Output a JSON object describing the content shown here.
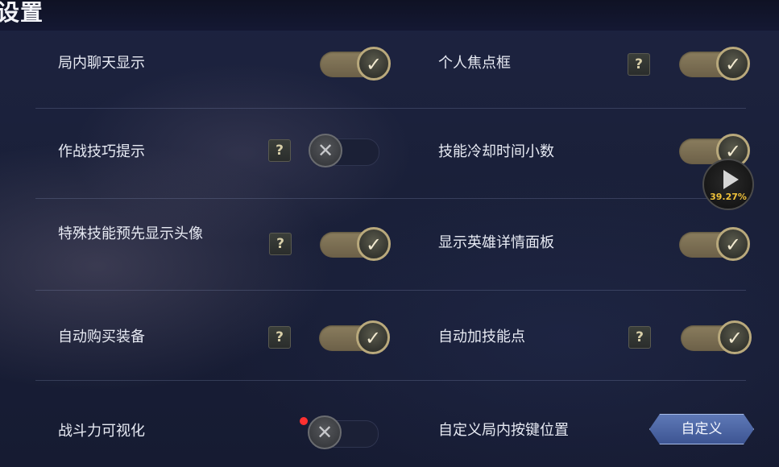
{
  "header": {
    "title": "设置"
  },
  "settings": {
    "chat_display": {
      "label": "局内聊天显示",
      "state": "on"
    },
    "personal_focus_frame": {
      "label": "个人焦点框",
      "help": "?",
      "state": "on"
    },
    "combat_tips": {
      "label": "作战技巧提示",
      "help": "?",
      "state": "off"
    },
    "cooldown_decimal": {
      "label": "技能冷却时间小数",
      "state": "on"
    },
    "special_skill_avatar": {
      "label": "特殊技能预先显示头像",
      "help": "?",
      "state": "on"
    },
    "hero_detail_panel": {
      "label": "显示英雄详情面板",
      "state": "on"
    },
    "auto_buy_equipment": {
      "label": "自动购买装备",
      "help": "?",
      "state": "on"
    },
    "auto_skill_points": {
      "label": "自动加技能点",
      "help": "?",
      "state": "on"
    },
    "combat_power_visual": {
      "label": "战斗力可视化",
      "state": "off",
      "new_dot": true
    },
    "custom_key_position": {
      "label": "自定义局内按键位置",
      "button_label": "自定义"
    }
  },
  "icons": {
    "on_knob": "check-icon",
    "off_knob": "close-icon"
  },
  "overlay": {
    "progress_text": "39.27%",
    "progress": 0.3927
  },
  "colors": {
    "accent_gold": "#b9a97c",
    "button_blue": "#4a64a4",
    "background": "#1a2039"
  }
}
